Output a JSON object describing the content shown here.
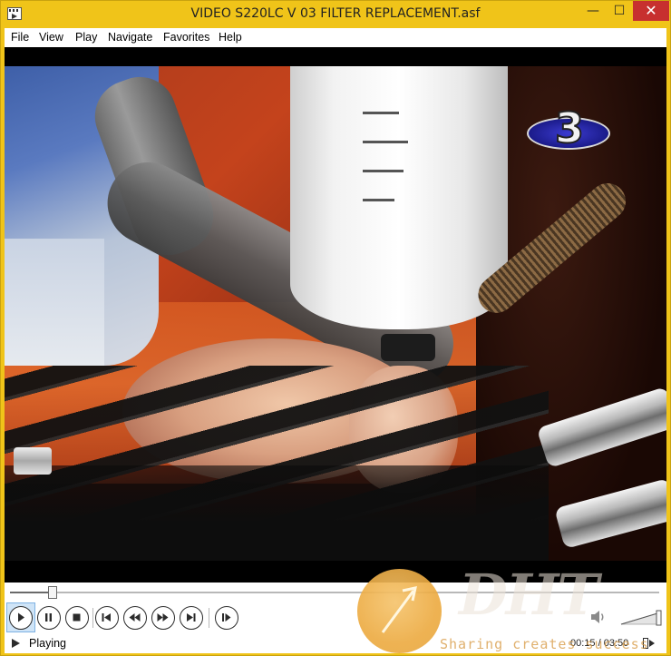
{
  "window": {
    "title": "VIDEO S220LC V 03 FILTER REPLACEMENT.asf",
    "icon": "media-player-icon",
    "controls": {
      "minimize": "—",
      "maximize": "☐",
      "close": "✕"
    }
  },
  "menu": {
    "items": [
      "File",
      "View",
      "Play",
      "Navigate",
      "Favorites",
      "Help"
    ]
  },
  "video": {
    "channel_number": "3",
    "seek_progress": 0.066
  },
  "playback_controls": [
    {
      "name": "play-button",
      "icon": "play-icon"
    },
    {
      "name": "pause-button",
      "icon": "pause-icon"
    },
    {
      "name": "stop-button",
      "icon": "stop-icon"
    },
    {
      "name": "previous-button",
      "icon": "skip-back-icon"
    },
    {
      "name": "rewind-button",
      "icon": "rewind-icon"
    },
    {
      "name": "fast-forward-button",
      "icon": "fast-forward-icon"
    },
    {
      "name": "next-button",
      "icon": "skip-forward-icon"
    },
    {
      "name": "frame-step-button",
      "icon": "frame-step-icon"
    }
  ],
  "status": {
    "state": "Playing",
    "time": "00:15 / 03:50"
  },
  "watermark": {
    "letters": "DHT",
    "tagline": "Sharing creates success"
  },
  "colors": {
    "window_frame": "#f0c419",
    "close_button": "#c7302f",
    "active_button_bg": "#cfe4f7"
  }
}
